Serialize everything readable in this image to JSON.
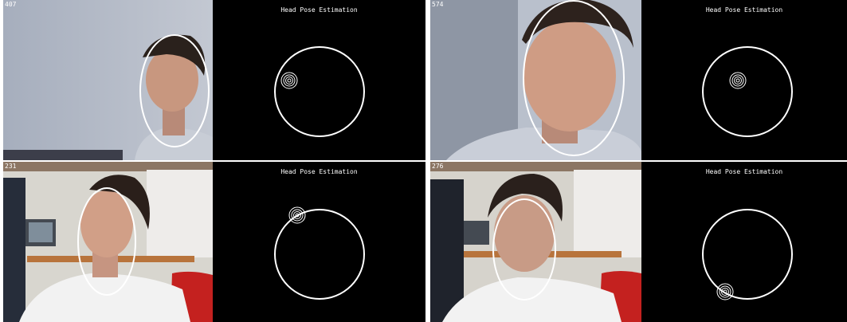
{
  "panels": [
    {
      "frame_id": "407",
      "viz_title": "Head Pose Estimation"
    },
    {
      "frame_id": "574",
      "viz_title": "Head Pose Estimation"
    },
    {
      "frame_id": "231",
      "viz_title": "Head Pose Estimation"
    },
    {
      "frame_id": "276",
      "viz_title": "Head Pose Estimation"
    }
  ],
  "colors": {
    "background": "#000000",
    "overlay": "#ffffff"
  }
}
